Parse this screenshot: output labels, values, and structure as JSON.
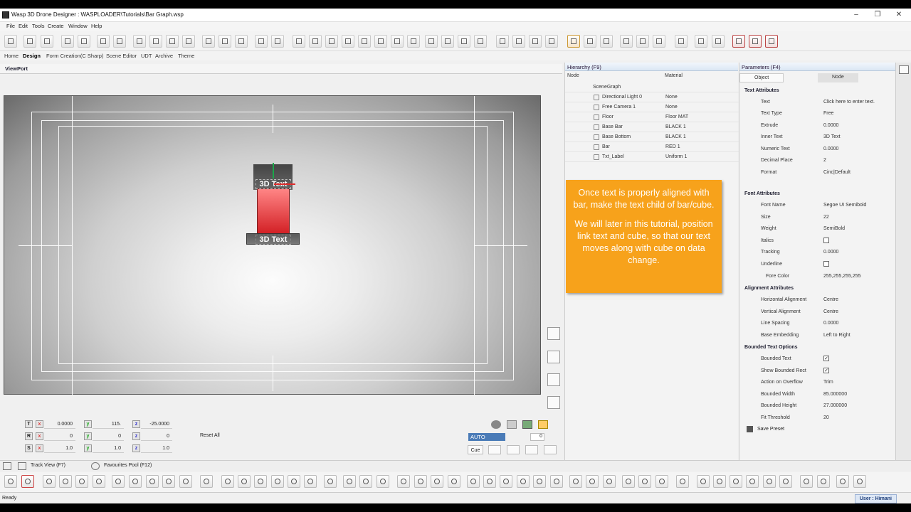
{
  "window": {
    "title": "Wasp 3D Drone Designer : WASPLOADER\\Tutorials\\Bar Graph.wsp",
    "minimize": "–",
    "maximize": "❐",
    "close": "✕"
  },
  "menu": [
    "File",
    "Edit",
    "Tools",
    "Create",
    "Window",
    "Help"
  ],
  "tabs": [
    "Home",
    "Design",
    "Form Creation(C Sharp)",
    "Scene Editor",
    "UDT",
    "Archive",
    "Theme"
  ],
  "viewport": {
    "label": "ViewPort",
    "top_label": "3D Text",
    "bottom_label": "3D Text"
  },
  "transform": {
    "rows": [
      {
        "label": "T",
        "x": "0.0000",
        "y": "115.",
        "z": "-25.0000"
      },
      {
        "label": "R",
        "x": "0",
        "y": "0",
        "z": "0"
      },
      {
        "label": "S",
        "x": "1.0",
        "y": "1.0",
        "z": "1.0"
      }
    ],
    "reset_label": "Reset All",
    "axis_x": "x",
    "axis_y": "y",
    "axis_z": "z"
  },
  "playback": {
    "auto_label": "AUTO",
    "cue_label": "Cue",
    "frame_value": "0"
  },
  "hierarchy": {
    "title": "Hierarchy (F9)",
    "col_node": "Node",
    "col_material": "Material",
    "root": "SceneGraph",
    "rows": [
      {
        "node": "Directional Light 0",
        "material": "None"
      },
      {
        "node": "Free Camera 1",
        "material": "None"
      },
      {
        "node": "Floor",
        "material": "Floor MAT"
      },
      {
        "node": "Base Bar",
        "material": "BLACK 1"
      },
      {
        "node": "Base Bottom",
        "material": "BLACK 1"
      },
      {
        "node": "Bar",
        "material": "RED 1"
      },
      {
        "node": "Txt_Label",
        "material": "Uniform 1"
      }
    ]
  },
  "callout": {
    "para1": "Once text is properly aligned with bar, make the text child of bar/cube.",
    "para2": "We will later in this tutorial, position link text and cube, so that our text moves along with cube on data change."
  },
  "parameters": {
    "title": "Parameters (F4)",
    "tab_object": "Object",
    "tab_node": "Node",
    "sections": [
      {
        "title": "Text Attributes",
        "rows": [
          {
            "k": "Text",
            "v": "Click here to enter text."
          },
          {
            "k": "Text Type",
            "v": "Free"
          },
          {
            "k": "Extrude",
            "v": "0.0000"
          },
          {
            "k": "Inner Text",
            "v": "3D Text"
          },
          {
            "k": "Numeric Text",
            "v": "0.0000"
          },
          {
            "k": "Decimal Place",
            "v": "2"
          },
          {
            "k": "Format",
            "v": "Cinc|Default"
          }
        ]
      },
      {
        "title": "Font Attributes",
        "rows": [
          {
            "k": "Font Name",
            "v": "Segoe UI Semibold"
          },
          {
            "k": "Size",
            "v": "22"
          },
          {
            "k": "Weight",
            "v": "SemiBold"
          },
          {
            "k": "Italics",
            "v": "",
            "check": false
          },
          {
            "k": "Tracking",
            "v": "0.0000"
          },
          {
            "k": "Underline",
            "v": "",
            "check": false
          },
          {
            "k": "Fore Color",
            "v": "255,255,255,255"
          }
        ]
      },
      {
        "title": "Alignment Attributes",
        "rows": [
          {
            "k": "Horizontal Alignment",
            "v": "Centre"
          },
          {
            "k": "Vertical Alignment",
            "v": "Centre"
          },
          {
            "k": "Line Spacing",
            "v": "0.0000"
          },
          {
            "k": "Base Embedding",
            "v": "Left to Right"
          }
        ]
      },
      {
        "title": "Bounded Text Options",
        "rows": [
          {
            "k": "Bounded Text",
            "v": "",
            "check": true
          },
          {
            "k": "Show Bounded Rect",
            "v": "",
            "check": true
          },
          {
            "k": "Action on Overflow",
            "v": "Trim"
          },
          {
            "k": "Bounded Width",
            "v": "85.000000"
          },
          {
            "k": "Bounded Height",
            "v": "27.000000"
          },
          {
            "k": "Fit Threshold",
            "v": "20"
          }
        ]
      }
    ],
    "save_preset": "Save Preset"
  },
  "bottom_tabs": [
    "Track View (F7)",
    "Favourites Pool (F12)"
  ],
  "status": {
    "text": "Ready",
    "user": "User : Himani"
  },
  "colors": {
    "accent": "#f7a21b",
    "cube": "#d21f24"
  }
}
